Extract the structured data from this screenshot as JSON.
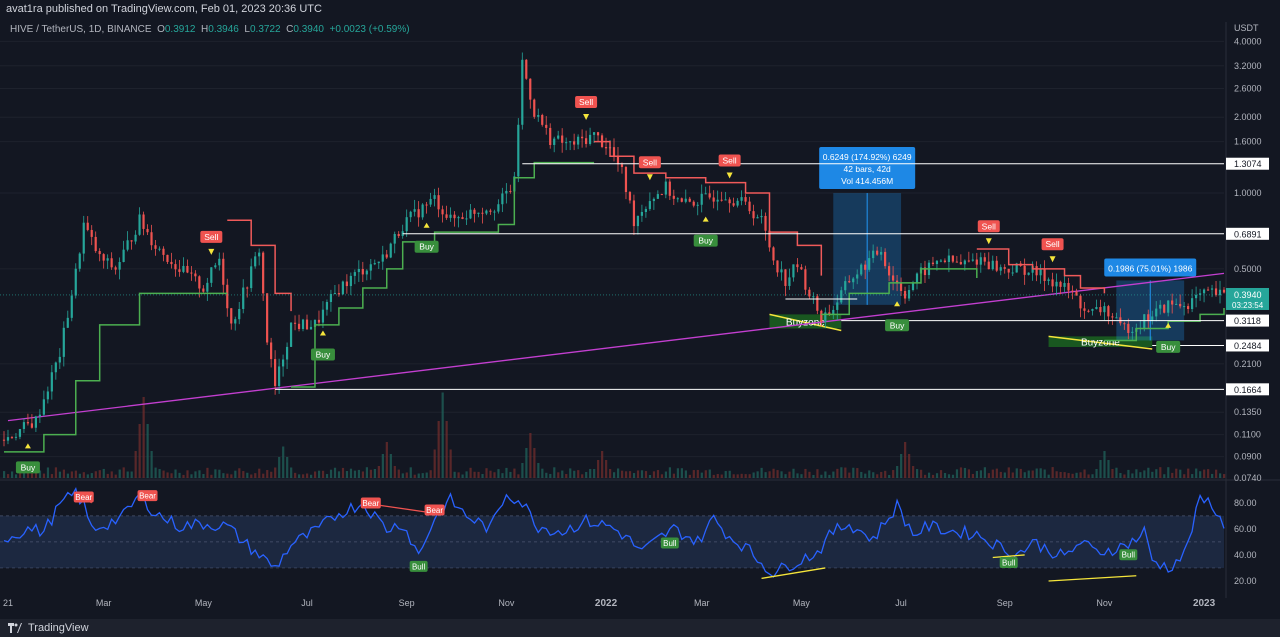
{
  "header": {
    "published": "avat1ra published on TradingView.com, Feb 01, 2023 20:36 UTC",
    "symbol": "HIVE / TetherUS, 1D, BINANCE",
    "o_label": "O",
    "o": "0.3912",
    "h_label": "H",
    "h": "0.3946",
    "l_label": "L",
    "l": "0.3722",
    "c_label": "C",
    "c": "0.3940",
    "change": "+0.0023 (+0.59%)"
  },
  "footer": {
    "brand": "TradingView"
  },
  "colors": {
    "background": "#131722",
    "grid": "#1e222d",
    "up": "#26a69a",
    "down": "#ef5350",
    "supertrend_bull": "#4caf50",
    "supertrend_bear": "#f05a5a",
    "trendline": "#c33fd0",
    "rsi": "#2962ff",
    "divergence": "#f5e53b",
    "measure": "#2196f3"
  },
  "chart_data": [
    {
      "type": "candlestick",
      "title": "",
      "currency": "USDT",
      "scale": "log",
      "ylim": [
        0.074,
        4.2
      ],
      "y_ticks": [
        "4.0000",
        "3.2000",
        "2.6000",
        "2.0000",
        "1.6000",
        "1.0000",
        "0.5000",
        "0.2100",
        "0.1350",
        "0.1100",
        "0.0900",
        "0.0740"
      ],
      "x_ticks": [
        "21",
        "Mar",
        "May",
        "Jul",
        "Sep",
        "Nov",
        "2022",
        "Mar",
        "May",
        "Jul",
        "Sep",
        "Nov",
        "2023"
      ],
      "price_lines": [
        "1.3074",
        "0.6891",
        "0.3118",
        "0.2484",
        "0.1664"
      ],
      "last_price": "0.3940",
      "countdown": "03:23:54",
      "path": [
        [
          0,
          0.105
        ],
        [
          8,
          0.125
        ],
        [
          14,
          0.23
        ],
        [
          18,
          0.48
        ],
        [
          20,
          0.75
        ],
        [
          24,
          0.55
        ],
        [
          28,
          0.5
        ],
        [
          34,
          0.78
        ],
        [
          38,
          0.62
        ],
        [
          44,
          0.5
        ],
        [
          50,
          0.42
        ],
        [
          54,
          0.55
        ],
        [
          57,
          0.3
        ],
        [
          60,
          0.4
        ],
        [
          64,
          0.6
        ],
        [
          66,
          0.26
        ],
        [
          68,
          0.17
        ],
        [
          72,
          0.3
        ],
        [
          78,
          0.3
        ],
        [
          84,
          0.42
        ],
        [
          90,
          0.5
        ],
        [
          95,
          0.55
        ],
        [
          100,
          0.75
        ],
        [
          104,
          0.85
        ],
        [
          108,
          0.95
        ],
        [
          112,
          0.78
        ],
        [
          118,
          0.85
        ],
        [
          124,
          0.9
        ],
        [
          128,
          1.1
        ],
        [
          130,
          3.3
        ],
        [
          133,
          2.1
        ],
        [
          137,
          1.65
        ],
        [
          142,
          1.55
        ],
        [
          148,
          1.7
        ],
        [
          152,
          1.5
        ],
        [
          155,
          1.2
        ],
        [
          158,
          0.78
        ],
        [
          162,
          0.95
        ],
        [
          166,
          1.05
        ],
        [
          170,
          0.9
        ],
        [
          176,
          0.95
        ],
        [
          180,
          1.0
        ],
        [
          186,
          0.9
        ],
        [
          190,
          0.78
        ],
        [
          193,
          0.55
        ],
        [
          196,
          0.45
        ],
        [
          199,
          0.52
        ],
        [
          202,
          0.4
        ],
        [
          205,
          0.32
        ],
        [
          208,
          0.35
        ],
        [
          212,
          0.45
        ],
        [
          216,
          0.52
        ],
        [
          220,
          0.6
        ],
        [
          222,
          0.48
        ],
        [
          226,
          0.4
        ],
        [
          230,
          0.48
        ],
        [
          235,
          0.55
        ],
        [
          240,
          0.52
        ],
        [
          245,
          0.55
        ],
        [
          250,
          0.5
        ],
        [
          256,
          0.5
        ],
        [
          262,
          0.46
        ],
        [
          268,
          0.4
        ],
        [
          272,
          0.33
        ],
        [
          276,
          0.35
        ],
        [
          280,
          0.29
        ],
        [
          284,
          0.3
        ],
        [
          288,
          0.33
        ],
        [
          292,
          0.36
        ],
        [
          296,
          0.36
        ],
        [
          300,
          0.39
        ],
        [
          303,
          0.4
        ],
        [
          306,
          0.39
        ]
      ],
      "volume_peaks": [
        [
          35,
          0.9
        ],
        [
          70,
          0.35
        ],
        [
          96,
          0.4
        ],
        [
          110,
          0.95
        ],
        [
          132,
          0.5
        ],
        [
          150,
          0.3
        ],
        [
          226,
          0.4
        ],
        [
          276,
          0.3
        ]
      ],
      "supertrend": [
        {
          "trend": "bull",
          "points": [
            [
              0,
              0.094
            ],
            [
              10,
              0.11
            ],
            [
              18,
              0.18
            ],
            [
              24,
              0.3
            ],
            [
              34,
              0.4
            ],
            [
              56,
              0.4
            ]
          ]
        },
        {
          "trend": "bear",
          "points": [
            [
              56,
              0.78
            ],
            [
              62,
              0.62
            ],
            [
              68,
              0.4
            ],
            [
              72,
              0.34
            ]
          ]
        },
        {
          "trend": "bull",
          "points": [
            [
              72,
              0.17
            ],
            [
              78,
              0.3
            ],
            [
              84,
              0.35
            ],
            [
              90,
              0.42
            ],
            [
              96,
              0.5
            ],
            [
              100,
              0.64
            ],
            [
              108,
              0.7
            ],
            [
              118,
              0.7
            ],
            [
              124,
              0.75
            ],
            [
              128,
              1.15
            ],
            [
              133,
              1.32
            ],
            [
              148,
              1.32
            ]
          ]
        },
        {
          "trend": "bear",
          "points": [
            [
              148,
              1.6
            ],
            [
              152,
              1.4
            ],
            [
              158,
              1.2
            ],
            [
              166,
              1.15
            ],
            [
              176,
              1.1
            ],
            [
              186,
              1.0
            ],
            [
              192,
              0.7
            ],
            [
              199,
              0.62
            ],
            [
              205,
              0.47
            ]
          ]
        },
        {
          "trend": "bull",
          "points": [
            [
              205,
              0.33
            ],
            [
              212,
              0.4
            ],
            [
              222,
              0.44
            ],
            [
              230,
              0.5
            ],
            [
              240,
              0.5
            ],
            [
              244,
              0.46
            ]
          ]
        },
        {
          "trend": "bear",
          "points": [
            [
              244,
              0.6
            ],
            [
              252,
              0.52
            ],
            [
              258,
              0.5
            ],
            [
              266,
              0.47
            ],
            [
              270,
              0.42
            ],
            [
              276,
              0.4
            ]
          ]
        },
        {
          "trend": "bull",
          "points": [
            [
              276,
              0.26
            ],
            [
              284,
              0.29
            ],
            [
              292,
              0.31
            ],
            [
              300,
              0.33
            ],
            [
              306,
              0.35
            ]
          ]
        }
      ],
      "trendline": [
        [
          1,
          0.125
        ],
        [
          306,
          0.48
        ]
      ],
      "signals": [
        {
          "label": "Buy",
          "i": 6,
          "side": "buy"
        },
        {
          "label": "Sell",
          "i": 52,
          "side": "sell"
        },
        {
          "label": "Buy",
          "i": 80,
          "side": "buy"
        },
        {
          "label": "Buy",
          "i": 106,
          "side": "buy"
        },
        {
          "label": "Sell",
          "i": 146,
          "side": "sell"
        },
        {
          "label": "Sell",
          "i": 162,
          "side": "sell"
        },
        {
          "label": "Buy",
          "i": 176,
          "side": "buy"
        },
        {
          "label": "Sell",
          "i": 182,
          "side": "sell"
        },
        {
          "label": "Buy",
          "i": 224,
          "side": "buy"
        },
        {
          "label": "Sell",
          "i": 247,
          "side": "sell"
        },
        {
          "label": "Sell",
          "i": 263,
          "side": "sell"
        },
        {
          "label": "Buy",
          "i": 292,
          "side": "buy"
        }
      ],
      "buyzones": [
        {
          "label": "Buyzone",
          "from": 192,
          "to": 210,
          "top": 0.33,
          "bottom": 0.29
        },
        {
          "label": "Buyzone",
          "from": 262,
          "to": 288,
          "top": 0.27,
          "bottom": 0.245
        }
      ],
      "measurements": [
        {
          "lines": [
            "0.6249 (174.92%) 6249",
            "42 bars, 42d",
            "Vol 414.456M"
          ],
          "from": 208,
          "to": 225,
          "low": 0.36,
          "high": 1.0
        },
        {
          "lines": [
            "0.1986 (75.01%) 1986"
          ],
          "from": 279,
          "to": 296,
          "low": 0.26,
          "high": 0.45
        }
      ]
    },
    {
      "type": "line",
      "title": "",
      "ylim": [
        10,
        96
      ],
      "y_ticks": [
        "80.00",
        "60.00",
        "40.00",
        "20.00"
      ],
      "band": [
        30,
        70
      ],
      "midline": 50,
      "series": [
        {
          "points": [
            [
              0,
              52
            ],
            [
              6,
              60
            ],
            [
              10,
              58
            ],
            [
              14,
              78
            ],
            [
              18,
              88
            ],
            [
              20,
              78
            ],
            [
              22,
              60
            ],
            [
              26,
              64
            ],
            [
              30,
              70
            ],
            [
              34,
              86
            ],
            [
              38,
              72
            ],
            [
              44,
              62
            ],
            [
              50,
              64
            ],
            [
              56,
              62
            ],
            [
              60,
              50
            ],
            [
              64,
              40
            ],
            [
              68,
              30
            ],
            [
              72,
              48
            ],
            [
              78,
              58
            ],
            [
              84,
              72
            ],
            [
              90,
              80
            ],
            [
              96,
              60
            ],
            [
              100,
              64
            ],
            [
              104,
              40
            ],
            [
              108,
              68
            ],
            [
              112,
              82
            ],
            [
              116,
              70
            ],
            [
              122,
              60
            ],
            [
              126,
              88
            ],
            [
              130,
              80
            ],
            [
              134,
              62
            ],
            [
              140,
              58
            ],
            [
              146,
              66
            ],
            [
              152,
              62
            ],
            [
              156,
              54
            ],
            [
              160,
              42
            ],
            [
              164,
              52
            ],
            [
              168,
              60
            ],
            [
              174,
              50
            ],
            [
              178,
              68
            ],
            [
              182,
              54
            ],
            [
              186,
              46
            ],
            [
              190,
              34
            ],
            [
              193,
              26
            ],
            [
              198,
              34
            ],
            [
              204,
              42
            ],
            [
              208,
              58
            ],
            [
              212,
              64
            ],
            [
              218,
              52
            ],
            [
              224,
              78
            ],
            [
              228,
              56
            ],
            [
              232,
              62
            ],
            [
              238,
              58
            ],
            [
              244,
              56
            ],
            [
              250,
              46
            ],
            [
              254,
              40
            ],
            [
              258,
              50
            ],
            [
              262,
              44
            ],
            [
              266,
              38
            ],
            [
              270,
              50
            ],
            [
              274,
              42
            ],
            [
              280,
              46
            ],
            [
              284,
              52
            ],
            [
              286,
              58
            ],
            [
              288,
              36
            ],
            [
              292,
              30
            ],
            [
              296,
              40
            ],
            [
              300,
              82
            ],
            [
              303,
              80
            ],
            [
              306,
              60
            ]
          ]
        }
      ],
      "signals": [
        {
          "label": "Bear",
          "i": 20,
          "kind": "bear"
        },
        {
          "label": "Bear",
          "i": 36,
          "kind": "bear"
        },
        {
          "label": "Bear",
          "i": 92,
          "kind": "bear"
        },
        {
          "label": "Bear",
          "i": 108,
          "kind": "bear"
        },
        {
          "label": "Bull",
          "i": 104,
          "kind": "bull"
        },
        {
          "label": "Bull",
          "i": 167,
          "kind": "bull"
        },
        {
          "label": "Bull",
          "i": 252,
          "kind": "bull"
        },
        {
          "label": "Bull",
          "i": 282,
          "kind": "bull"
        }
      ],
      "divergences": [
        {
          "kind": "bear",
          "from": [
            18,
            88
          ],
          "to": [
            22,
            80
          ]
        },
        {
          "kind": "bear",
          "from": [
            90,
            80
          ],
          "to": [
            108,
            72
          ]
        },
        {
          "kind": "bull",
          "from": [
            190,
            22
          ],
          "to": [
            206,
            30
          ]
        },
        {
          "kind": "bull",
          "from": [
            248,
            38
          ],
          "to": [
            256,
            40
          ]
        },
        {
          "kind": "bull",
          "from": [
            262,
            20
          ],
          "to": [
            284,
            24
          ]
        }
      ]
    }
  ]
}
